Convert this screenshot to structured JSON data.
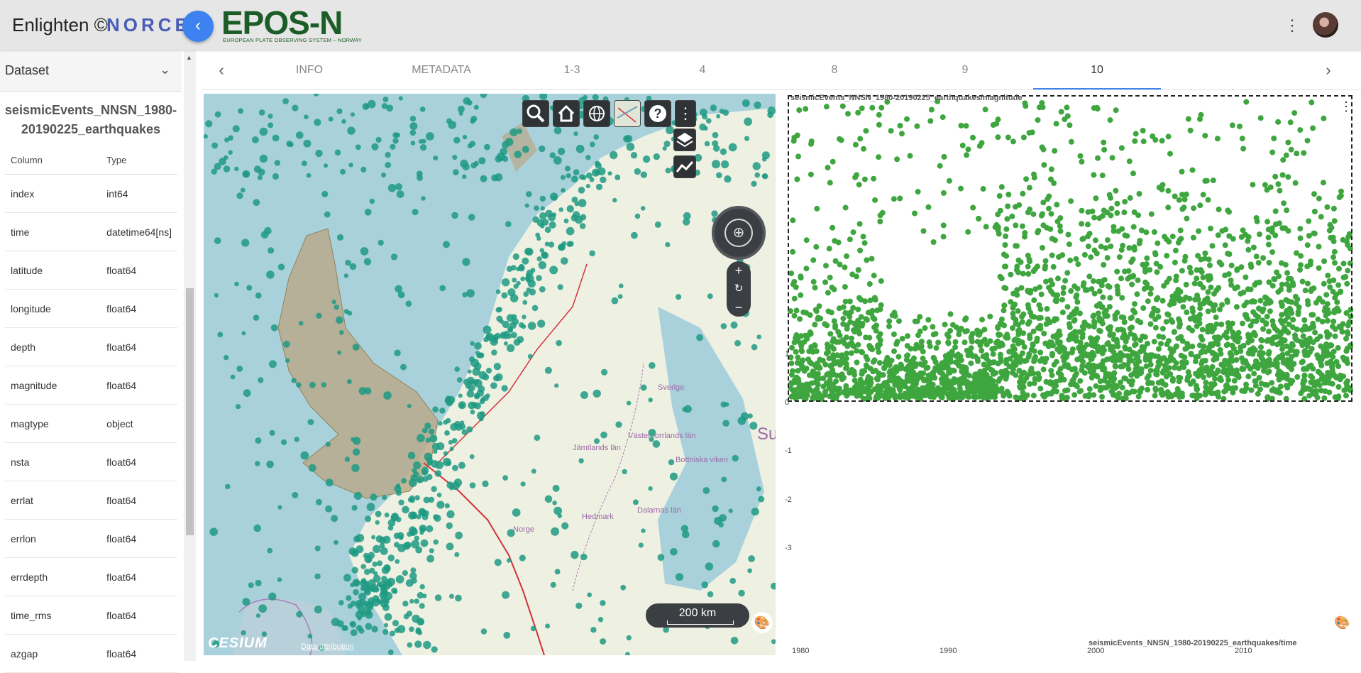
{
  "header": {
    "app_title": "Enlighten ©",
    "norce_logo": "NORCE",
    "epos_title": "EPOS-N",
    "epos_subtitle": "EUROPEAN PLATE OBSERVING SYSTEM  –  NORWAY",
    "collapse_icon": "chevron-left-icon",
    "menu_icon": "more-vert-icon"
  },
  "sidebar": {
    "dataset_label": "Dataset",
    "dataset_name": "seismicEvents_NNSN_1980-20190225_earthquakes",
    "columns_header": {
      "column": "Column",
      "type": "Type"
    },
    "columns": [
      {
        "name": "index",
        "type": "int64"
      },
      {
        "name": "time",
        "type": "datetime64[ns]"
      },
      {
        "name": "latitude",
        "type": "float64"
      },
      {
        "name": "longitude",
        "type": "float64"
      },
      {
        "name": "depth",
        "type": "float64"
      },
      {
        "name": "magnitude",
        "type": "float64"
      },
      {
        "name": "magtype",
        "type": "object"
      },
      {
        "name": "nsta",
        "type": "float64"
      },
      {
        "name": "errlat",
        "type": "float64"
      },
      {
        "name": "errlon",
        "type": "float64"
      },
      {
        "name": "errdepth",
        "type": "float64"
      },
      {
        "name": "time_rms",
        "type": "float64"
      },
      {
        "name": "azgap",
        "type": "float64"
      }
    ]
  },
  "tabs": [
    {
      "label": "INFO",
      "active": false
    },
    {
      "label": "METADATA",
      "active": false
    },
    {
      "label": "1-3",
      "active": false
    },
    {
      "label": "4",
      "active": false
    },
    {
      "label": "8",
      "active": false
    },
    {
      "label": "9",
      "active": false
    },
    {
      "label": "10",
      "active": true
    }
  ],
  "map": {
    "scale_label": "200 km",
    "credit": "CESIUM",
    "data_attribution": "Data attribution",
    "place_labels": [
      "Norge",
      "Sverige",
      "Jämtlands län",
      "Västernorrlands län",
      "Dalarnas län",
      "Hedmark",
      "Bottniska viken",
      "Su"
    ],
    "toolbar_icons": [
      "search-icon",
      "home-icon",
      "globe-icon",
      "map-layer-icon",
      "help-icon",
      "more-vert-icon"
    ],
    "side_icons": [
      "layers-icon",
      "chart-line-icon"
    ],
    "point_color": "#1e9a82"
  },
  "plot": {
    "title": "seismicEvents_NNSN_1980-20190225_earthquakes/magnitude",
    "x_label": "seismicEvents_NNSN_1980-20190225_earthquakes/time",
    "y_ticks": [
      "1",
      "0",
      "-1",
      "-2",
      "-3"
    ],
    "x_ticks": [
      "1980",
      "1990",
      "2000",
      "2010"
    ],
    "point_color": "#3fa63f"
  }
}
